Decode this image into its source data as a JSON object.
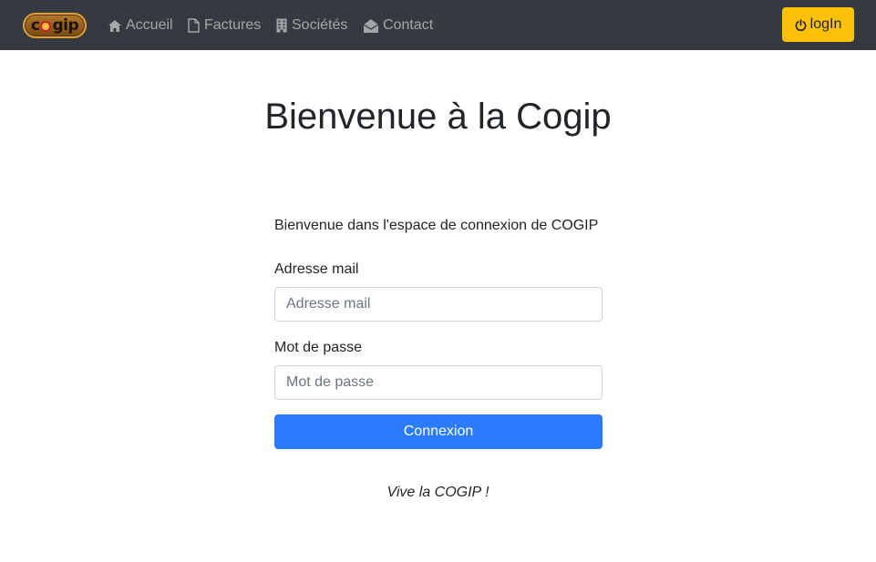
{
  "navbar": {
    "logo_text": "cogip",
    "links": [
      {
        "label": "Accueil",
        "icon": "home-icon"
      },
      {
        "label": "Factures",
        "icon": "document-icon"
      },
      {
        "label": "Sociétés",
        "icon": "building-icon"
      },
      {
        "label": "Contact",
        "icon": "envelope-open-icon"
      }
    ],
    "login_label": "logIn",
    "login_icon": "power-icon"
  },
  "main": {
    "title": "Bienvenue à la Cogip",
    "intro": "Bienvenue dans l'espace de connexion de COGIP",
    "email_label": "Adresse mail",
    "email_placeholder": "Adresse mail",
    "email_value": "",
    "password_label": "Mot de passe",
    "password_placeholder": "Mot de passe",
    "password_value": "",
    "submit_label": "Connexion",
    "footer_note": "Vive la COGIP !"
  },
  "colors": {
    "navbar_bg": "#343a40",
    "login_button": "#ffc107",
    "primary_button": "#2b7bfe"
  }
}
